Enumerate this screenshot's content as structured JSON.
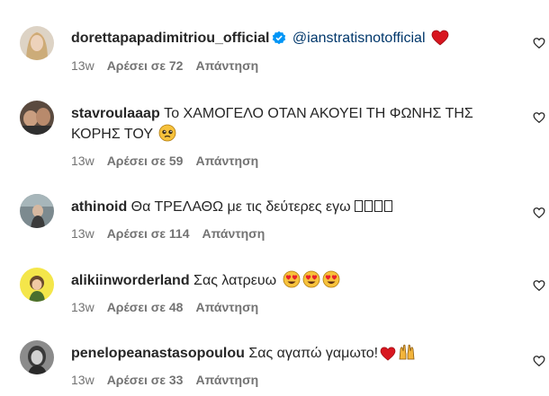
{
  "comments": [
    {
      "username": "dorettapapadimitriou_official",
      "verified": true,
      "text": "",
      "mention": "@ianstratisnotofficial",
      "emoji": "red-heart",
      "time": "13w",
      "likes": "Αρέσει σε 72",
      "reply": "Απάντηση"
    },
    {
      "username": "stavroulaaap",
      "text": "Το ΧΑΜΟΓΕΛΟ ΟΤΑΝ ΑΚΟΥΕΙ ΤΗ ΦΩΝΗΣ ΤΗΣ ΚΟΡΗΣ ΤΟΥ",
      "emoji": "pleading-face",
      "time": "13w",
      "likes": "Αρέσει σε 59",
      "reply": "Απάντηση"
    },
    {
      "username": "athinoid",
      "text": "Θα ΤΡΕΛΑΘΩ με τις δεύτερες εγω",
      "emoji": "unrendered-glyph-boxes",
      "time": "13w",
      "likes": "Αρέσει σε 114",
      "reply": "Απάντηση"
    },
    {
      "username": "alikiinworderland",
      "text": "Σας λατρευω",
      "emoji": "heart-eyes-face",
      "time": "13w",
      "likes": "Αρέσει σε 48",
      "reply": "Απάντηση"
    },
    {
      "username": "penelopeanastasopoulou",
      "text": "Σας αγαπώ γαμωτο!",
      "emoji": "red-heart-and-raised-hands",
      "time": "13w",
      "likes": "Αρέσει σε 33",
      "reply": "Απάντηση"
    }
  ],
  "icons": {
    "like": "heart-outline-icon",
    "verified": "verified-badge-icon"
  },
  "colors": {
    "text": "#262626",
    "meta": "#737373",
    "mention": "#00376b",
    "verified": "#0095f6",
    "heart": "#ed1c24"
  }
}
